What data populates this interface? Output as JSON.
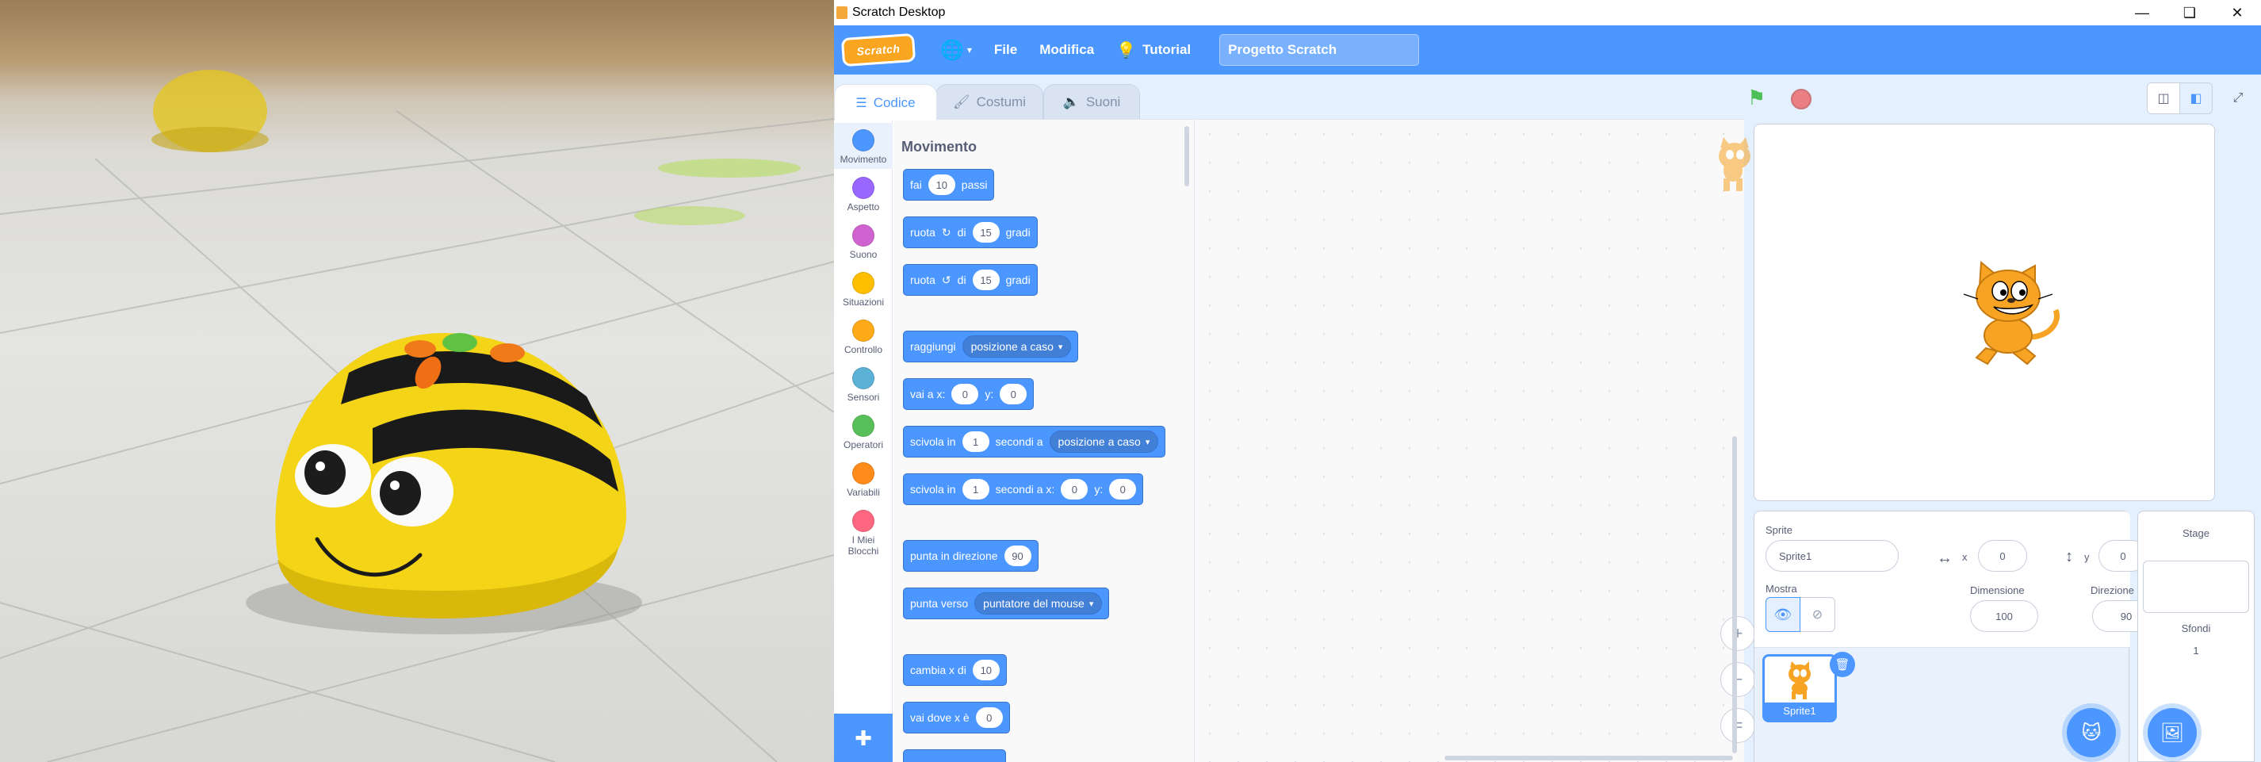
{
  "window": {
    "title": "Scratch Desktop",
    "controls": [
      "minimize",
      "restore",
      "close"
    ]
  },
  "menubar": {
    "logo": "Scratch",
    "file": "File",
    "edit": "Modifica",
    "tutorial": "Tutorial",
    "project_title": "Progetto Scratch"
  },
  "tabs": [
    {
      "label": "Codice"
    },
    {
      "label": "Costumi"
    },
    {
      "label": "Suoni"
    }
  ],
  "categories": [
    {
      "label": "Movimento",
      "color": "#4c97ff"
    },
    {
      "label": "Aspetto",
      "color": "#9966ff"
    },
    {
      "label": "Suono",
      "color": "#cf63cf"
    },
    {
      "label": "Situazioni",
      "color": "#ffbf00"
    },
    {
      "label": "Controllo",
      "color": "#ffab19"
    },
    {
      "label": "Sensori",
      "color": "#5cb1d6"
    },
    {
      "label": "Operatori",
      "color": "#59c059"
    },
    {
      "label": "Variabili",
      "color": "#ff8c1a"
    },
    {
      "label": "I Miei Blocchi",
      "color": "#ff6680"
    }
  ],
  "palette": {
    "title": "Movimento",
    "move": {
      "a": "fai",
      "n": "10",
      "b": "passi"
    },
    "turn_right": {
      "a": "ruota",
      "b": "di",
      "n": "15",
      "c": "gradi"
    },
    "turn_left": {
      "a": "ruota",
      "b": "di",
      "n": "15",
      "c": "gradi"
    },
    "goto": {
      "a": "raggiungi",
      "dd": "posizione a caso"
    },
    "goxy": {
      "a": "vai a x:",
      "x": "0",
      "b": "y:",
      "y": "0"
    },
    "glide": {
      "a": "scivola in",
      "n": "1",
      "b": "secondi a",
      "dd": "posizione a caso"
    },
    "glidexy": {
      "a": "scivola in",
      "n": "1",
      "b": "secondi a x:",
      "x": "0",
      "c": "y:",
      "y": "0"
    },
    "point_dir": {
      "a": "punta in direzione",
      "n": "90"
    },
    "point_to": {
      "a": "punta verso",
      "dd": "puntatore del mouse"
    },
    "change_x": {
      "a": "cambia x di",
      "n": "10"
    },
    "set_x": {
      "a": "vai dove x è",
      "n": "0"
    }
  },
  "zoom": {
    "in": "+",
    "out": "−",
    "reset": "="
  },
  "sprite_info": {
    "sprite_label": "Sprite",
    "name": "Sprite1",
    "x_label": "x",
    "x": "0",
    "y_label": "y",
    "y": "0",
    "show_label": "Mostra",
    "size_label": "Dimensione",
    "size": "100",
    "direction_label": "Direzione",
    "direction": "90"
  },
  "sprites": [
    {
      "name": "Sprite1"
    }
  ],
  "stage_panel": {
    "title": "Stage",
    "backdrops_label": "Sfondi",
    "backdrops_count": "1"
  },
  "colors": {
    "accent": "#4c97ff",
    "menubar": "#4c97ff",
    "motion": "#4c97ff"
  }
}
